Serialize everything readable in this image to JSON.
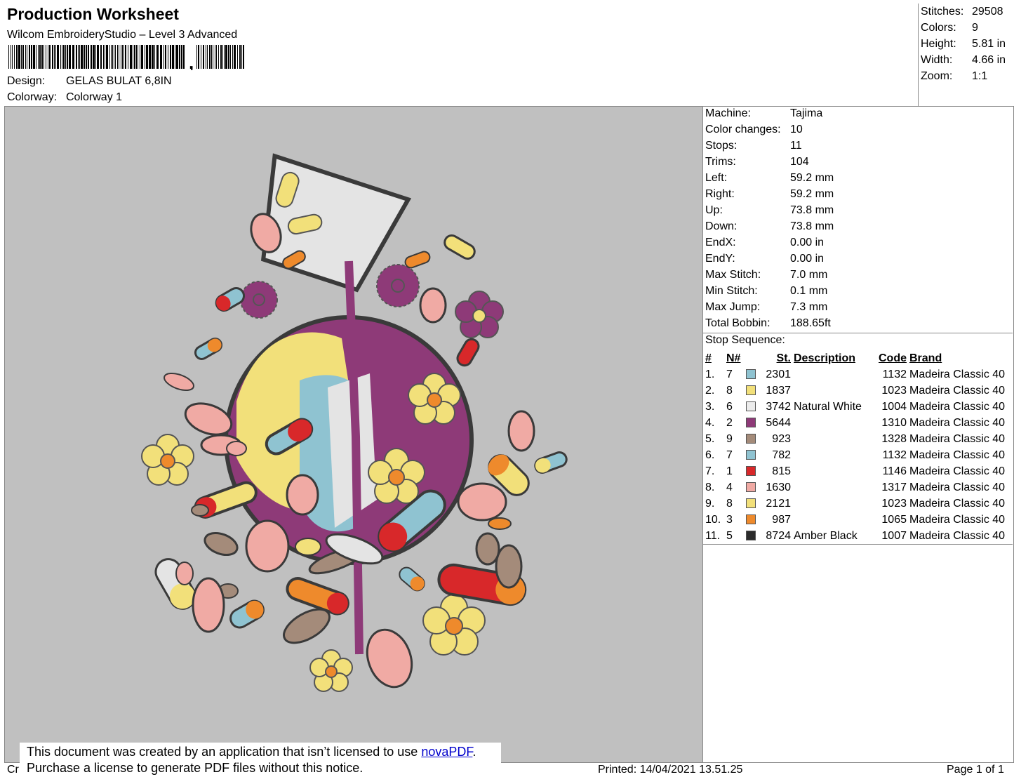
{
  "header": {
    "title": "Production Worksheet",
    "software": "Wilcom EmbroideryStudio – Level 3 Advanced",
    "barcode_suffix": ",",
    "design_label": "Design:",
    "design_value": "GELAS BULAT 6,8IN",
    "colorway_label": "Colorway:",
    "colorway_value": "Colorway 1"
  },
  "summary": [
    {
      "label": "Stitches:",
      "value": "29508"
    },
    {
      "label": "Colors:",
      "value": "9"
    },
    {
      "label": "Height:",
      "value": "5.81 in"
    },
    {
      "label": "Width:",
      "value": "4.66 in"
    },
    {
      "label": "Zoom:",
      "value": "1:1"
    }
  ],
  "machine_info": [
    {
      "label": "Machine:",
      "value": "Tajima"
    },
    {
      "label": "Color changes:",
      "value": "10"
    },
    {
      "label": "Stops:",
      "value": "11"
    },
    {
      "label": "Trims:",
      "value": "104"
    },
    {
      "label": "Left:",
      "value": "59.2 mm"
    },
    {
      "label": "Right:",
      "value": "59.2 mm"
    },
    {
      "label": "Up:",
      "value": "73.8 mm"
    },
    {
      "label": "Down:",
      "value": "73.8 mm"
    },
    {
      "label": "EndX:",
      "value": "0.00 in"
    },
    {
      "label": "EndY:",
      "value": "0.00 in"
    },
    {
      "label": "Max Stitch:",
      "value": "7.0 mm"
    },
    {
      "label": "Min Stitch:",
      "value": "0.1 mm"
    },
    {
      "label": "Max Jump:",
      "value": "7.3 mm"
    },
    {
      "label": "Total Bobbin:",
      "value": "188.65ft"
    }
  ],
  "stop_sequence": {
    "title": "Stop Sequence:",
    "headers": [
      "#",
      "N#",
      "St.",
      "Description",
      "Code",
      "Brand"
    ],
    "rows": [
      {
        "num": "1.",
        "n": "7",
        "color": "#8fc3d1",
        "st": "2301",
        "desc": "",
        "code": "1132",
        "brand": "Madeira Classic 40"
      },
      {
        "num": "2.",
        "n": "8",
        "color": "#f2e07a",
        "st": "1837",
        "desc": "",
        "code": "1023",
        "brand": "Madeira Classic 40"
      },
      {
        "num": "3.",
        "n": "6",
        "color": "#ececec",
        "st": "3742",
        "desc": "Natural White",
        "code": "1004",
        "brand": "Madeira Classic 40"
      },
      {
        "num": "4.",
        "n": "2",
        "color": "#8e3a78",
        "st": "5644",
        "desc": "",
        "code": "1310",
        "brand": "Madeira Classic 40"
      },
      {
        "num": "5.",
        "n": "9",
        "color": "#a48b7a",
        "st": "923",
        "desc": "",
        "code": "1328",
        "brand": "Madeira Classic 40"
      },
      {
        "num": "6.",
        "n": "7",
        "color": "#8fc3d1",
        "st": "782",
        "desc": "",
        "code": "1132",
        "brand": "Madeira Classic 40"
      },
      {
        "num": "7.",
        "n": "1",
        "color": "#d8282a",
        "st": "815",
        "desc": "",
        "code": "1146",
        "brand": "Madeira Classic 40"
      },
      {
        "num": "8.",
        "n": "4",
        "color": "#f0aaa4",
        "st": "1630",
        "desc": "",
        "code": "1317",
        "brand": "Madeira Classic 40"
      },
      {
        "num": "9.",
        "n": "8",
        "color": "#f2e07a",
        "st": "2121",
        "desc": "",
        "code": "1023",
        "brand": "Madeira Classic 40"
      },
      {
        "num": "10.",
        "n": "3",
        "color": "#ee8a2c",
        "st": "987",
        "desc": "",
        "code": "1065",
        "brand": "Madeira Classic 40"
      },
      {
        "num": "11.",
        "n": "5",
        "color": "#2b2b2b",
        "st": "8724",
        "desc": "Amber Black",
        "code": "1007",
        "brand": "Madeira Classic 40"
      }
    ]
  },
  "notice": {
    "line1_prefix": "This document was created by an application that isn’t licensed to use ",
    "link": "novaPDF",
    "line1_suffix": ".",
    "line2": "Purchase a license to generate PDF files without this notice."
  },
  "footer": {
    "left_fragment": "Cr",
    "printed": "Printed: 14/04/2021 13.51.25",
    "page": "Page 1 of 1"
  }
}
